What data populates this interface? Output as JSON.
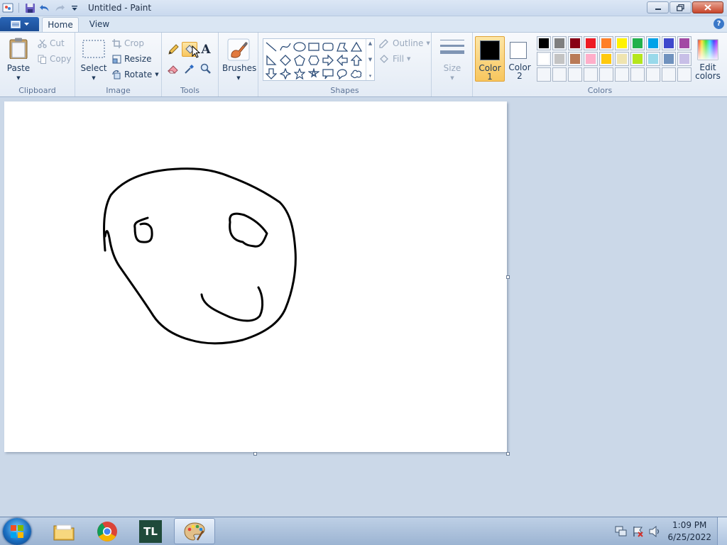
{
  "window": {
    "title": "Untitled - Paint"
  },
  "tabs": {
    "file_menu": "File menu",
    "home": "Home",
    "view": "View",
    "help": "?"
  },
  "clipboard": {
    "group": "Clipboard",
    "paste": "Paste",
    "cut": "Cut",
    "copy": "Copy"
  },
  "image": {
    "group": "Image",
    "select": "Select",
    "crop": "Crop",
    "resize": "Resize",
    "rotate": "Rotate"
  },
  "tools": {
    "group": "Tools",
    "text_glyph": "A",
    "active_tool": "fill"
  },
  "brushes": {
    "label": "Brushes"
  },
  "shapes": {
    "group": "Shapes",
    "outline": "Outline",
    "fill": "Fill"
  },
  "size": {
    "label": "Size"
  },
  "colors": {
    "group": "Colors",
    "color1_label": "Color\n1",
    "color2_label": "Color\n2",
    "color1_value": "#000000",
    "color2_value": "#ffffff",
    "edit": "Edit\ncolors",
    "palette_row1": [
      "#000000",
      "#7f7f7f",
      "#880015",
      "#ed1c24",
      "#ff7f27",
      "#fff200",
      "#22b14c",
      "#00a2e8",
      "#3f48cc",
      "#a349a4"
    ],
    "palette_row2": [
      "#ffffff",
      "#c3c3c3",
      "#b97a57",
      "#ffaec9",
      "#ffc90e",
      "#efe4b0",
      "#b5e61d",
      "#99d9ea",
      "#7092be",
      "#c8bfe7"
    ]
  },
  "taskbar": {
    "apps": [
      "windows-explorer",
      "google-chrome",
      "tl-app",
      "paint"
    ],
    "tl_label": "TL",
    "time": "1:09 PM",
    "date": "6/25/2022"
  }
}
